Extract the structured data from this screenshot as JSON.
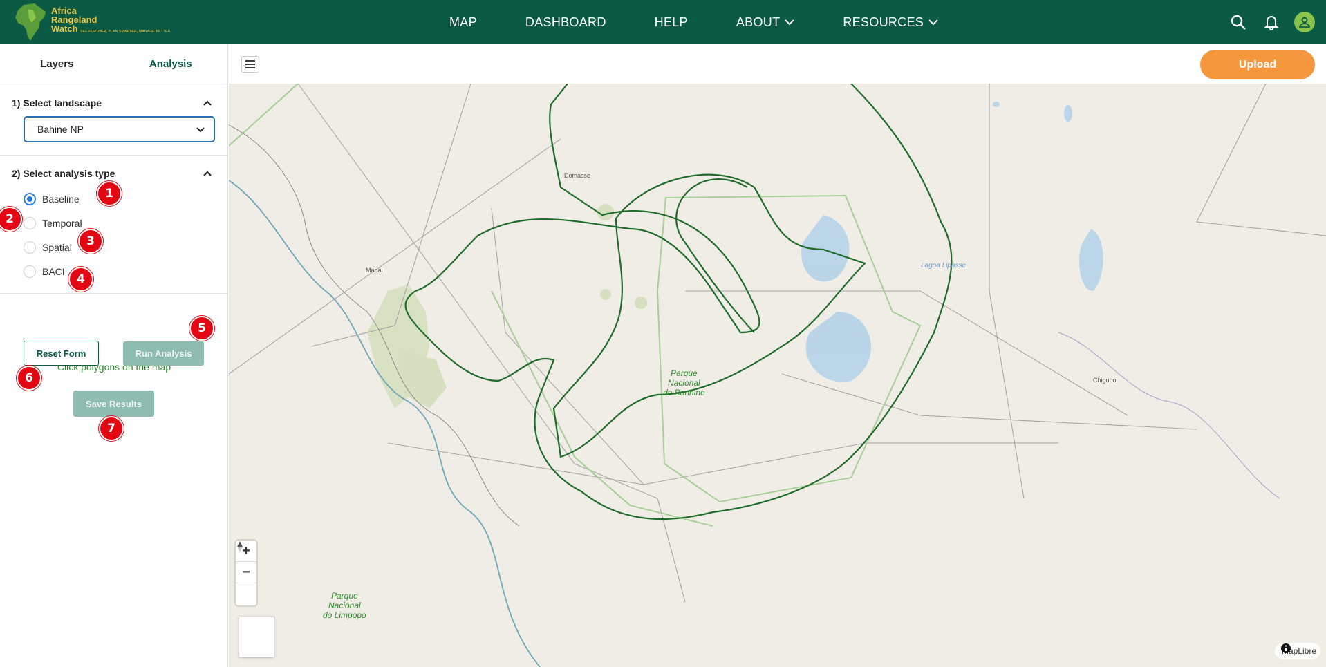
{
  "app": {
    "logo_line1": "Africa",
    "logo_line2": "Rangeland",
    "logo_line3": "Watch",
    "logo_tagline": "SEE FURTHER, PLAN SMARTER, MANAGE BETTER"
  },
  "nav": {
    "items": [
      {
        "label": "MAP"
      },
      {
        "label": "DASHBOARD"
      },
      {
        "label": "HELP"
      },
      {
        "label": "ABOUT"
      },
      {
        "label": "RESOURCES"
      }
    ]
  },
  "sidebar": {
    "tabs": [
      {
        "label": "Layers"
      },
      {
        "label": "Analysis"
      }
    ],
    "section1_title": "1) Select landscape",
    "landscape_value": "Bahine NP",
    "section2_title": "2) Select analysis type",
    "analysis_types": [
      {
        "label": "Baseline",
        "checked": true
      },
      {
        "label": "Temporal",
        "checked": false
      },
      {
        "label": "Spatial",
        "checked": false
      },
      {
        "label": "BACI",
        "checked": false
      }
    ],
    "hint": "Click polygons on the map",
    "reset_label": "Reset Form",
    "run_label": "Run Analysis",
    "save_label": "Save Results"
  },
  "badges": [
    "1",
    "2",
    "3",
    "4",
    "5",
    "6",
    "7"
  ],
  "map": {
    "upload_label": "Upload",
    "zoom_in": "+",
    "zoom_out": "−",
    "attribution": "MapLibre",
    "places": {
      "domasse": "Domasse",
      "mapai": "Mapai",
      "chigubo": "Chigubo",
      "lagoa": "Lagoa Lipasse",
      "banhine_1": "Parque",
      "banhine_2": "Nacional",
      "banhine_3": "de Banhine",
      "limpopo_1": "Parque",
      "limpopo_2": "Nacional",
      "limpopo_3": "do Limpopo"
    }
  },
  "colors": {
    "header": "#0b5a44",
    "accent": "#f5973c",
    "badge": "#e30613",
    "polygon": "#1f6b2a"
  }
}
